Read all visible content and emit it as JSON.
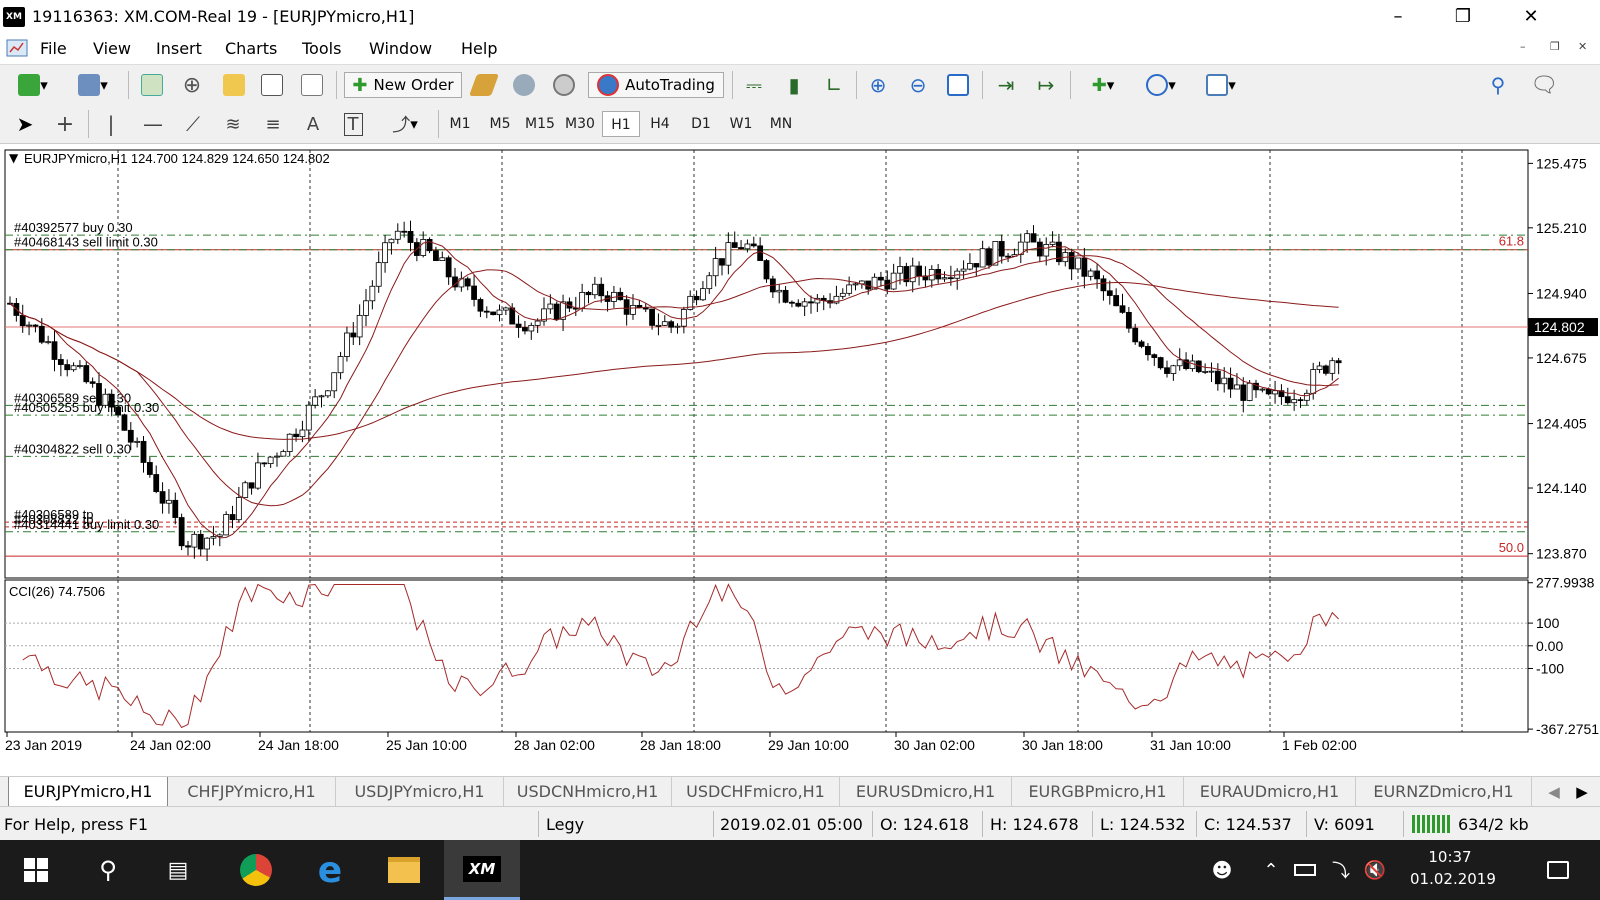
{
  "window": {
    "title": "19116363: XM.COM-Real 19 - [EURJPYmicro,H1]",
    "logo": "XM"
  },
  "menu": [
    "File",
    "View",
    "Insert",
    "Charts",
    "Tools",
    "Window",
    "Help"
  ],
  "toolbar": {
    "new_order": "New Order",
    "autotrading": "AutoTrading"
  },
  "periods": [
    "M1",
    "M5",
    "M15",
    "M30",
    "H1",
    "H4",
    "D1",
    "W1",
    "MN"
  ],
  "active_period": "H1",
  "chart": {
    "symbol_header": "EURJPYmicro,H1  124.700 124.829 124.650 124.802",
    "current_price": "124.802",
    "cci_label": "CCI(26) 74.7506",
    "price_axis": [
      "125.475",
      "125.210",
      "124.940",
      "124.675",
      "124.405",
      "124.140",
      "123.870"
    ],
    "cci_axis": [
      "277.9938",
      "100",
      "0.00",
      "-100",
      "-367.2751"
    ],
    "time_axis": [
      "23 Jan 2019",
      "24 Jan 02:00",
      "24 Jan 18:00",
      "25 Jan 10:00",
      "28 Jan 02:00",
      "28 Jan 18:00",
      "29 Jan 10:00",
      "30 Jan 02:00",
      "30 Jan 18:00",
      "31 Jan 10:00",
      "1 Feb 02:00"
    ],
    "fib_labels": [
      "61.8",
      "50.0"
    ],
    "orders": [
      {
        "label": "#40392577 buy 0.30",
        "price": 125.18
      },
      {
        "label": "#40468143 sell limit 0.30",
        "price": 125.12
      },
      {
        "label": "#40306589 sell 0.30",
        "price": 124.48
      },
      {
        "label": "#40505255 buy limit 0.30",
        "price": 124.44
      },
      {
        "label": "#40304822 sell 0.30",
        "price": 124.27
      },
      {
        "label": "#40306589 tp",
        "price": 124.0
      },
      {
        "label": "#40308822 tp",
        "price": 123.98
      },
      {
        "label": "#40314441 buy limit 0.30",
        "price": 123.96
      }
    ]
  },
  "tabs": [
    "EURJPYmicro,H1",
    "CHFJPYmicro,H1",
    "USDJPYmicro,H1",
    "USDCNHmicro,H1",
    "USDCHFmicro,H1",
    "EURUSDmicro,H1",
    "EURGBPmicro,H1",
    "EURAUDmicro,H1",
    "EURNZDmicro,H1"
  ],
  "status": {
    "help": "For Help, press F1",
    "profile": "Legy",
    "datetime": "2019.02.01 05:00",
    "open": "O: 124.618",
    "high": "H: 124.678",
    "low": "L: 124.532",
    "close": "C: 124.537",
    "volume": "V: 6091",
    "traffic": "634/2 kb"
  },
  "clock": {
    "time": "10:37",
    "date": "01.02.2019"
  },
  "colors": {
    "ma": "#8b1a1a",
    "fib": "#c62828",
    "order_line": "#2e7d32",
    "cci": "#a52a2a"
  }
}
